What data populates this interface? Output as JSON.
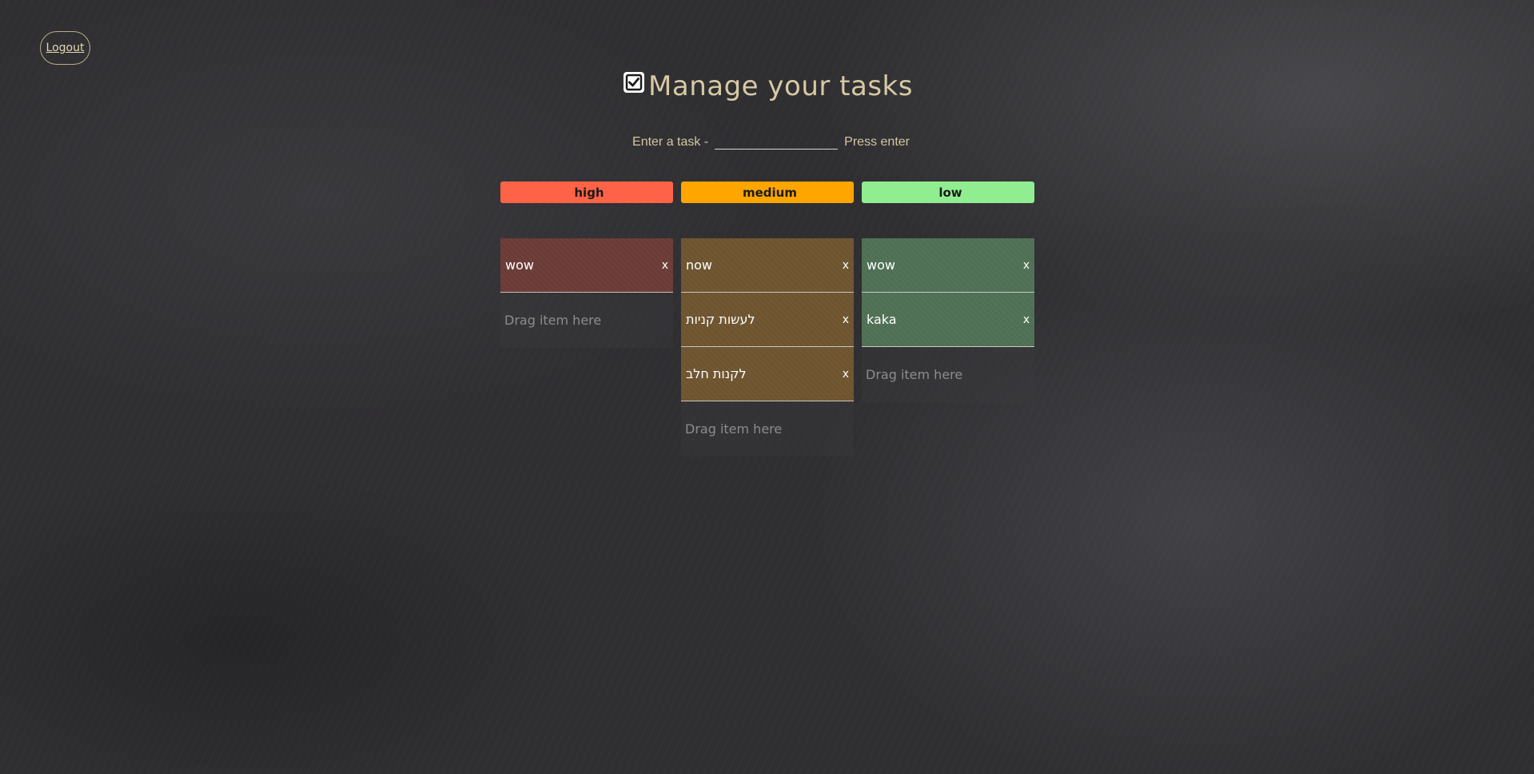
{
  "header": {
    "logout_label": "Logout",
    "title": "Manage your tasks",
    "title_icon": "checkbox-checked-icon"
  },
  "entry": {
    "label": "Enter a task -",
    "input_value": "",
    "hint": "Press enter"
  },
  "columns": [
    {
      "name": "high",
      "header_color": "#ff6347",
      "task_color": "#6b3c37",
      "tasks": [
        {
          "text": "wow",
          "close": "x"
        }
      ],
      "drop_label": "Drag item here"
    },
    {
      "name": "medium",
      "header_color": "#ffa500",
      "task_color": "#6e5530",
      "tasks": [
        {
          "text": "now",
          "close": "x"
        },
        {
          "text": "לעשות קניות",
          "close": "x"
        },
        {
          "text": "לקנות חלב",
          "close": "x"
        }
      ],
      "drop_label": "Drag item here"
    },
    {
      "name": "low",
      "header_color": "#90ee90",
      "task_color": "#4f7054",
      "tasks": [
        {
          "text": "wow",
          "close": "x"
        },
        {
          "text": "kaka",
          "close": "x"
        }
      ],
      "drop_label": "Drag item here"
    }
  ]
}
